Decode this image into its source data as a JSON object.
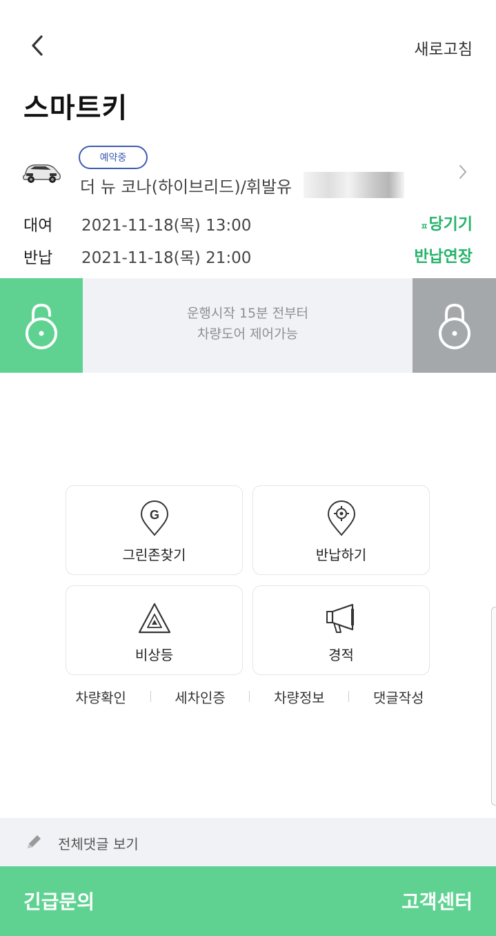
{
  "header": {
    "back_icon": "chevron-left-icon",
    "refresh_label": "새로고침",
    "title": "스마트키"
  },
  "reservation": {
    "status_badge": "예약중",
    "car_name": "더 뉴 코나(하이브리드)/휘발유",
    "car_icon": "car-thumbnail",
    "chevron_icon": "chevron-right-icon"
  },
  "rental": {
    "label": "대여",
    "datetime": "2021-11-18(목) 13:00",
    "action_prefix": "ㅍ",
    "action": "당기기"
  },
  "return": {
    "label": "반납",
    "datetime": "2021-11-18(목) 21:00",
    "action": "반납연장"
  },
  "lock_control": {
    "message_line1": "운행시작 15분 전부터",
    "message_line2": "차량도어 제어가능",
    "unlock_icon": "unlock-icon",
    "lock_icon": "lock-icon",
    "unlock_color": "#5fd292",
    "lock_color": "#a4a8ab"
  },
  "functions": [
    {
      "label": "그린존찾기",
      "icon": "greenzone-pin-icon"
    },
    {
      "label": "반납하기",
      "icon": "target-pin-icon"
    },
    {
      "label": "비상등",
      "icon": "hazard-triangle-icon"
    },
    {
      "label": "경적",
      "icon": "megaphone-icon"
    }
  ],
  "links": [
    "차량확인",
    "세차인증",
    "차량정보",
    "댓글작성"
  ],
  "comments": {
    "icon": "pencil-icon",
    "label": "전체댓글 보기"
  },
  "bottom_bar": {
    "left": "긴급문의",
    "right": "고객센터",
    "color": "#5fd292"
  },
  "colors": {
    "accent_green": "#27b36b",
    "badge_blue": "#3b5ab0"
  }
}
